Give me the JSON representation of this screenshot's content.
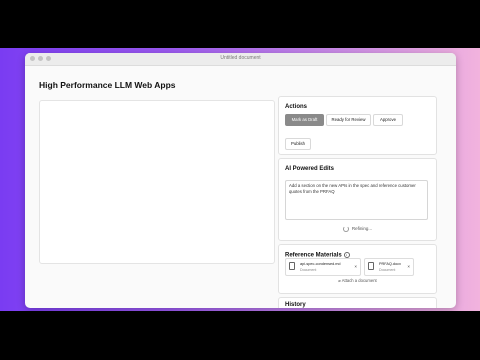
{
  "window": {
    "title": "Untitled document"
  },
  "page": {
    "title": "High Performance LLM Web Apps"
  },
  "actions": {
    "title": "Actions",
    "buttons": [
      "Mark as Draft",
      "Ready for Review",
      "Approve",
      "Publish"
    ],
    "active": "Mark as Draft"
  },
  "ai_edits": {
    "title": "AI Powered Edits",
    "prompt": "Add a section on the new APIs in the spec and reference customer quotes from the PRFAQ",
    "status": "Refining..."
  },
  "references": {
    "title": "Reference Materials",
    "docs": [
      {
        "name": "api-spec-condensed.md",
        "type": "Document"
      },
      {
        "name": "PRFAQ.docx",
        "type": "Document"
      }
    ],
    "attach_label": "Attach a document"
  },
  "history": {
    "title": "History"
  },
  "colors": {
    "accent": "#8a8a8a",
    "background_gradient_start": "#7a3cf2",
    "background_gradient_end": "#f2b3de"
  }
}
